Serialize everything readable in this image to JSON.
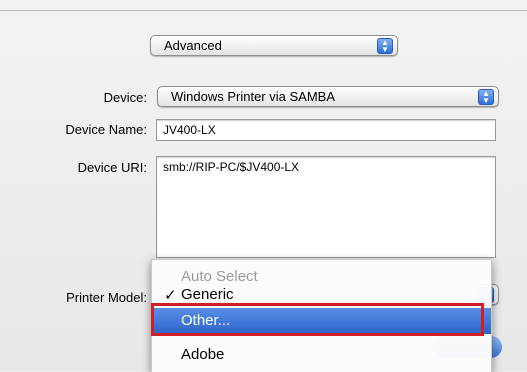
{
  "colors": {
    "selection": "#3a73d6",
    "highlight_border": "#d01f26",
    "disabled_text": "#9a9a9a"
  },
  "top_popup": {
    "value": "Advanced"
  },
  "form": {
    "device_label": "Device:",
    "device_value": "Windows Printer via SAMBA",
    "device_name_label": "Device Name:",
    "device_name_value": "JV400-LX",
    "device_uri_label": "Device URI:",
    "device_uri_value": "smb://RIP-PC/$JV400-LX",
    "printer_model_label": "Printer Model:"
  },
  "printer_model_menu": {
    "items": [
      {
        "label": "Auto Select",
        "disabled": true
      },
      {
        "label": "Generic",
        "checked": true,
        "check_glyph": "✓"
      },
      {
        "label": "Other...",
        "selected": true
      },
      {
        "label": "Adobe"
      }
    ]
  },
  "icons": {
    "popup_arrows": "up-down-arrows-icon",
    "checkmark": "checkmark-icon"
  }
}
